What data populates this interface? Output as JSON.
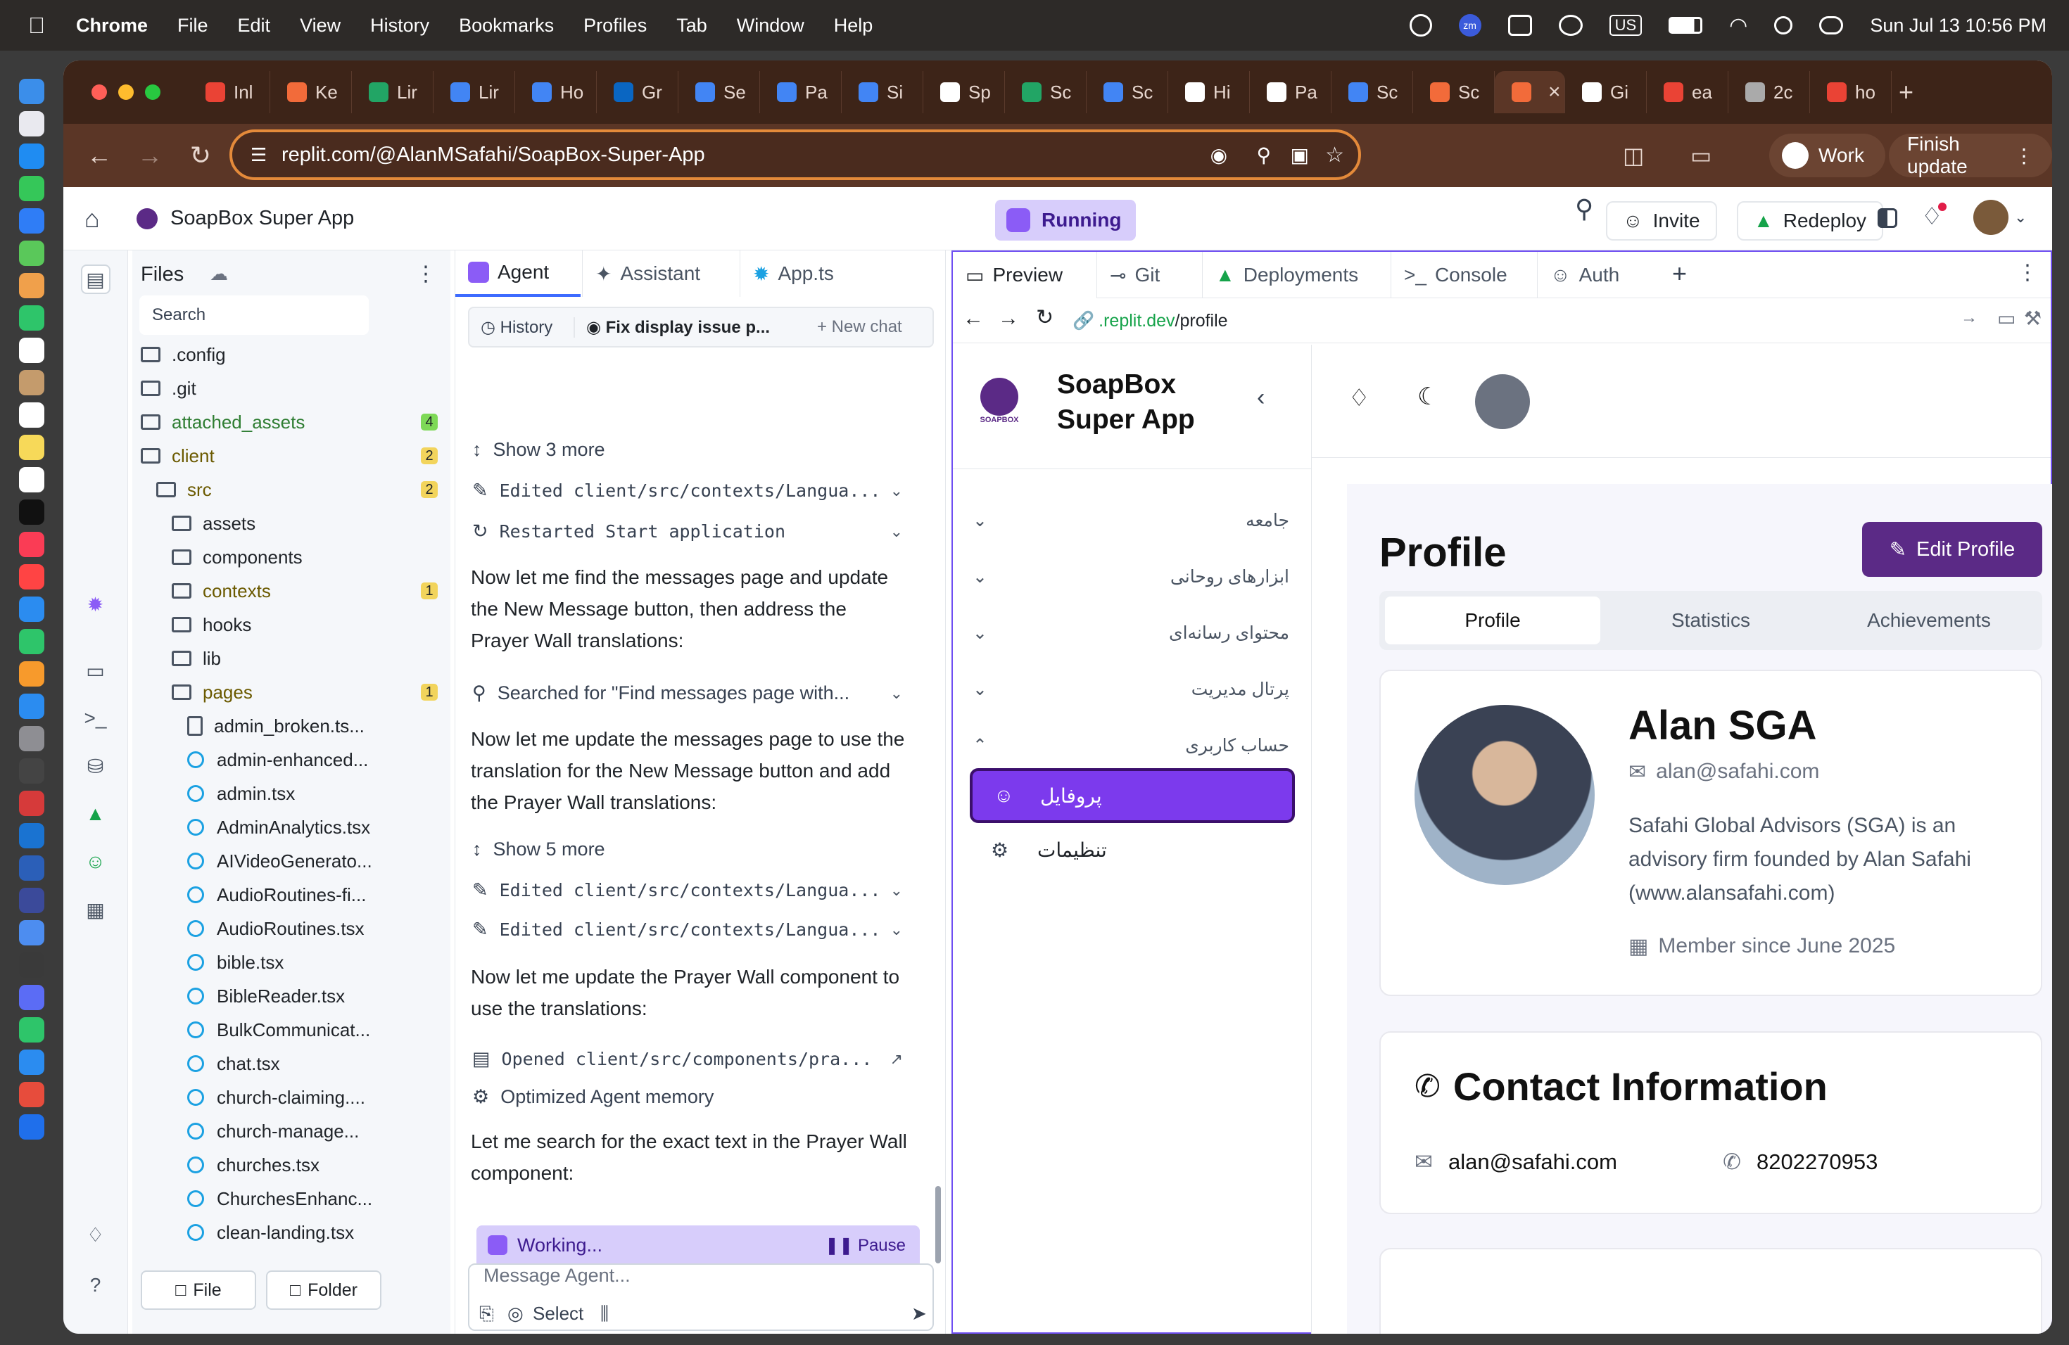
{
  "menubar": {
    "app": "Chrome",
    "items": [
      "File",
      "Edit",
      "View",
      "History",
      "Bookmarks",
      "Profiles",
      "Tab",
      "Window",
      "Help"
    ],
    "input_lang": "US",
    "datetime": "Sun Jul 13  10:56 PM"
  },
  "browser": {
    "tabs": [
      "Inl",
      "Ke",
      "Lir",
      "Lir",
      "Ho",
      "Gr",
      "Se",
      "Pa",
      "Si",
      "Sp",
      "Sc",
      "Sc",
      "Hi",
      "Pa",
      "Sc",
      "Sc",
      "",
      "Gi",
      "ea",
      "2c",
      "ho"
    ],
    "url": "replit.com/@AlanMSafahi/SoapBox-Super-App",
    "profile": "Work",
    "finish_update": "Finish update"
  },
  "replit": {
    "project": "SoapBox Super App",
    "status": "Running",
    "invite": "Invite",
    "redeploy": "Redeploy"
  },
  "files": {
    "title": "Files",
    "search_placeholder": "Search",
    "tree": [
      {
        "name": ".config",
        "type": "folder",
        "depth": 0
      },
      {
        "name": ".git",
        "type": "folder",
        "depth": 0
      },
      {
        "name": "attached_assets",
        "type": "folder",
        "depth": 0,
        "badge": "4",
        "badge_color": "green"
      },
      {
        "name": "client",
        "type": "folder-open",
        "depth": 0,
        "badge": "2"
      },
      {
        "name": "src",
        "type": "folder-open",
        "depth": 1,
        "badge": "2"
      },
      {
        "name": "assets",
        "type": "folder",
        "depth": 2
      },
      {
        "name": "components",
        "type": "folder",
        "depth": 2
      },
      {
        "name": "contexts",
        "type": "folder",
        "depth": 2,
        "badge": "1"
      },
      {
        "name": "hooks",
        "type": "folder",
        "depth": 2
      },
      {
        "name": "lib",
        "type": "folder",
        "depth": 2
      },
      {
        "name": "pages",
        "type": "folder-open",
        "depth": 2,
        "badge": "1"
      },
      {
        "name": "admin_broken.ts...",
        "type": "file",
        "depth": 3
      },
      {
        "name": "admin-enhanced...",
        "type": "react",
        "depth": 3
      },
      {
        "name": "admin.tsx",
        "type": "react",
        "depth": 3
      },
      {
        "name": "AdminAnalytics.tsx",
        "type": "react",
        "depth": 3
      },
      {
        "name": "AIVideoGenerato...",
        "type": "react",
        "depth": 3
      },
      {
        "name": "AudioRoutines-fi...",
        "type": "react",
        "depth": 3
      },
      {
        "name": "AudioRoutines.tsx",
        "type": "react",
        "depth": 3
      },
      {
        "name": "bible.tsx",
        "type": "react",
        "depth": 3
      },
      {
        "name": "BibleReader.tsx",
        "type": "react",
        "depth": 3
      },
      {
        "name": "BulkCommunicat...",
        "type": "react",
        "depth": 3
      },
      {
        "name": "chat.tsx",
        "type": "react",
        "depth": 3
      },
      {
        "name": "church-claiming....",
        "type": "react",
        "depth": 3
      },
      {
        "name": "church-manage...",
        "type": "react",
        "depth": 3
      },
      {
        "name": "churches.tsx",
        "type": "react",
        "depth": 3
      },
      {
        "name": "ChurchesEnhanc...",
        "type": "react",
        "depth": 3
      },
      {
        "name": "clean-landing.tsx",
        "type": "react",
        "depth": 3
      }
    ],
    "new_file": "File",
    "new_folder": "Folder"
  },
  "agent": {
    "tabs": [
      "Agent",
      "Assistant",
      "App.ts"
    ],
    "history": "History",
    "chat_title": "Fix display issue p...",
    "new_chat": "+ New chat",
    "show3": "Show 3 more",
    "edited1": "Edited client/src/contexts/Langua...",
    "restarted": "Restarted Start application",
    "msg1": "Now let me find the messages page and update the New Message button, then address the Prayer Wall translations:",
    "searched": "Searched for \"Find messages page with...",
    "msg2": "Now let me update the messages page to use the translation for the New Message button and add the Prayer Wall translations:",
    "show5": "Show 5 more",
    "edited2": "Edited client/src/contexts/Langua...",
    "edited3": "Edited client/src/contexts/Langua...",
    "msg3": "Now let me update the Prayer Wall component to use the translations:",
    "opened": "Opened client/src/components/pra...",
    "optimized": "Optimized Agent memory",
    "msg4": "Let me search for the exact text in the Prayer Wall component:",
    "working": "Working...",
    "pause": "Pause",
    "input_placeholder": "Message Agent...",
    "select": "Select"
  },
  "preview": {
    "tabs": [
      "Preview",
      "Git",
      "Deployments",
      "Console",
      "Auth"
    ],
    "url_host": ".replit.dev",
    "url_path": "/profile",
    "app_name_line1": "SoapBox",
    "app_name_line2": "Super App",
    "logo_text": "SOAPBOX",
    "menu": [
      "جامعه",
      "ابزارهای روحانی",
      "محتوای رسانه‌ای",
      "پرتال مدیریت",
      "حساب کاربری"
    ],
    "submenu_active": "پروفایل",
    "submenu_settings": "تنظیمات",
    "page_title": "Profile",
    "edit_profile": "Edit Profile",
    "profile_tabs": [
      "Profile",
      "Statistics",
      "Achievements"
    ],
    "user_name": "Alan SGA",
    "user_email": "alan@safahi.com",
    "bio": "Safahi Global Advisors (SGA) is an advisory firm founded by Alan Safahi (www.alansafahi.com)",
    "member_since": "Member since June 2025",
    "contact_title": "Contact Information",
    "contact_email": "alan@safahi.com",
    "contact_phone": "8202270953"
  },
  "colors": {
    "accent_purple": "#6f4ff2",
    "app_purple": "#5b2a86",
    "running_bg": "#d7cdfb",
    "tab_bar": "#3d2418"
  }
}
